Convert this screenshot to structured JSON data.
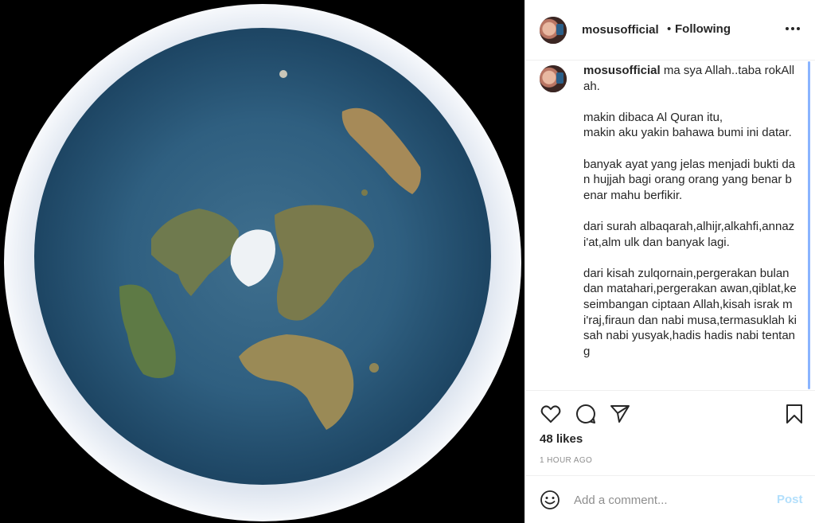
{
  "post": {
    "image_alt": "flat earth map",
    "header": {
      "username": "mosusofficial",
      "separator": "•",
      "follow_status": "Following",
      "more_icon": "more-horizontal-icon"
    },
    "caption": {
      "username": "mosusofficial",
      "text": " ma sya Allah..taba rokAllah.\n\nmakin dibaca Al Quran itu,\nmakin aku yakin bahawa bumi ini datar.\n\nbanyak ayat yang jelas menjadi bukti dan hujjah bagi orang orang yang benar benar mahu berfikir.\n\ndari surah albaqarah,alhijr,alkahfi,annazi'at,alm ulk dan banyak lagi.\n\ndari kisah zulqornain,pergerakan bulan dan matahari,pergerakan awan,qiblat,keseimbangan ciptaan Allah,kisah israk mi'raj,firaun dan nabi musa,termasuklah kisah nabi yusyak,hadis hadis nabi tentang"
    },
    "likes": "48 likes",
    "timestamp": "1 HOUR AGO",
    "comment": {
      "placeholder": "Add a comment...",
      "value": "",
      "post_label": "Post"
    },
    "icons": {
      "like": "heart-icon",
      "comment": "comment-icon",
      "share": "share-icon",
      "save": "bookmark-icon",
      "emoji": "emoji-icon"
    },
    "colors": {
      "post_disabled": "#b2dffc",
      "secondary_text": "#8e8e8e",
      "primary_text": "#262626"
    }
  }
}
